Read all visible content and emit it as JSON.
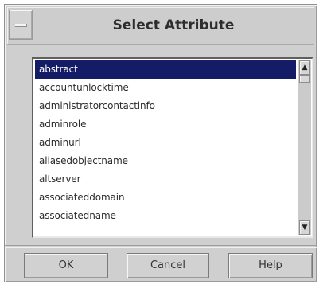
{
  "dialog": {
    "title": "Select Attribute"
  },
  "attributes": [
    "abstract",
    "accountunlocktime",
    "administratorcontactinfo",
    "adminrole",
    "adminurl",
    "aliasedobjectname",
    "altserver",
    "associateddomain",
    "associatedname"
  ],
  "selected_index": 0,
  "buttons": {
    "ok": "OK",
    "cancel": "Cancel",
    "help": "Help"
  },
  "colors": {
    "selection": "#141c66",
    "dialog_bg": "#cfcfcf"
  }
}
